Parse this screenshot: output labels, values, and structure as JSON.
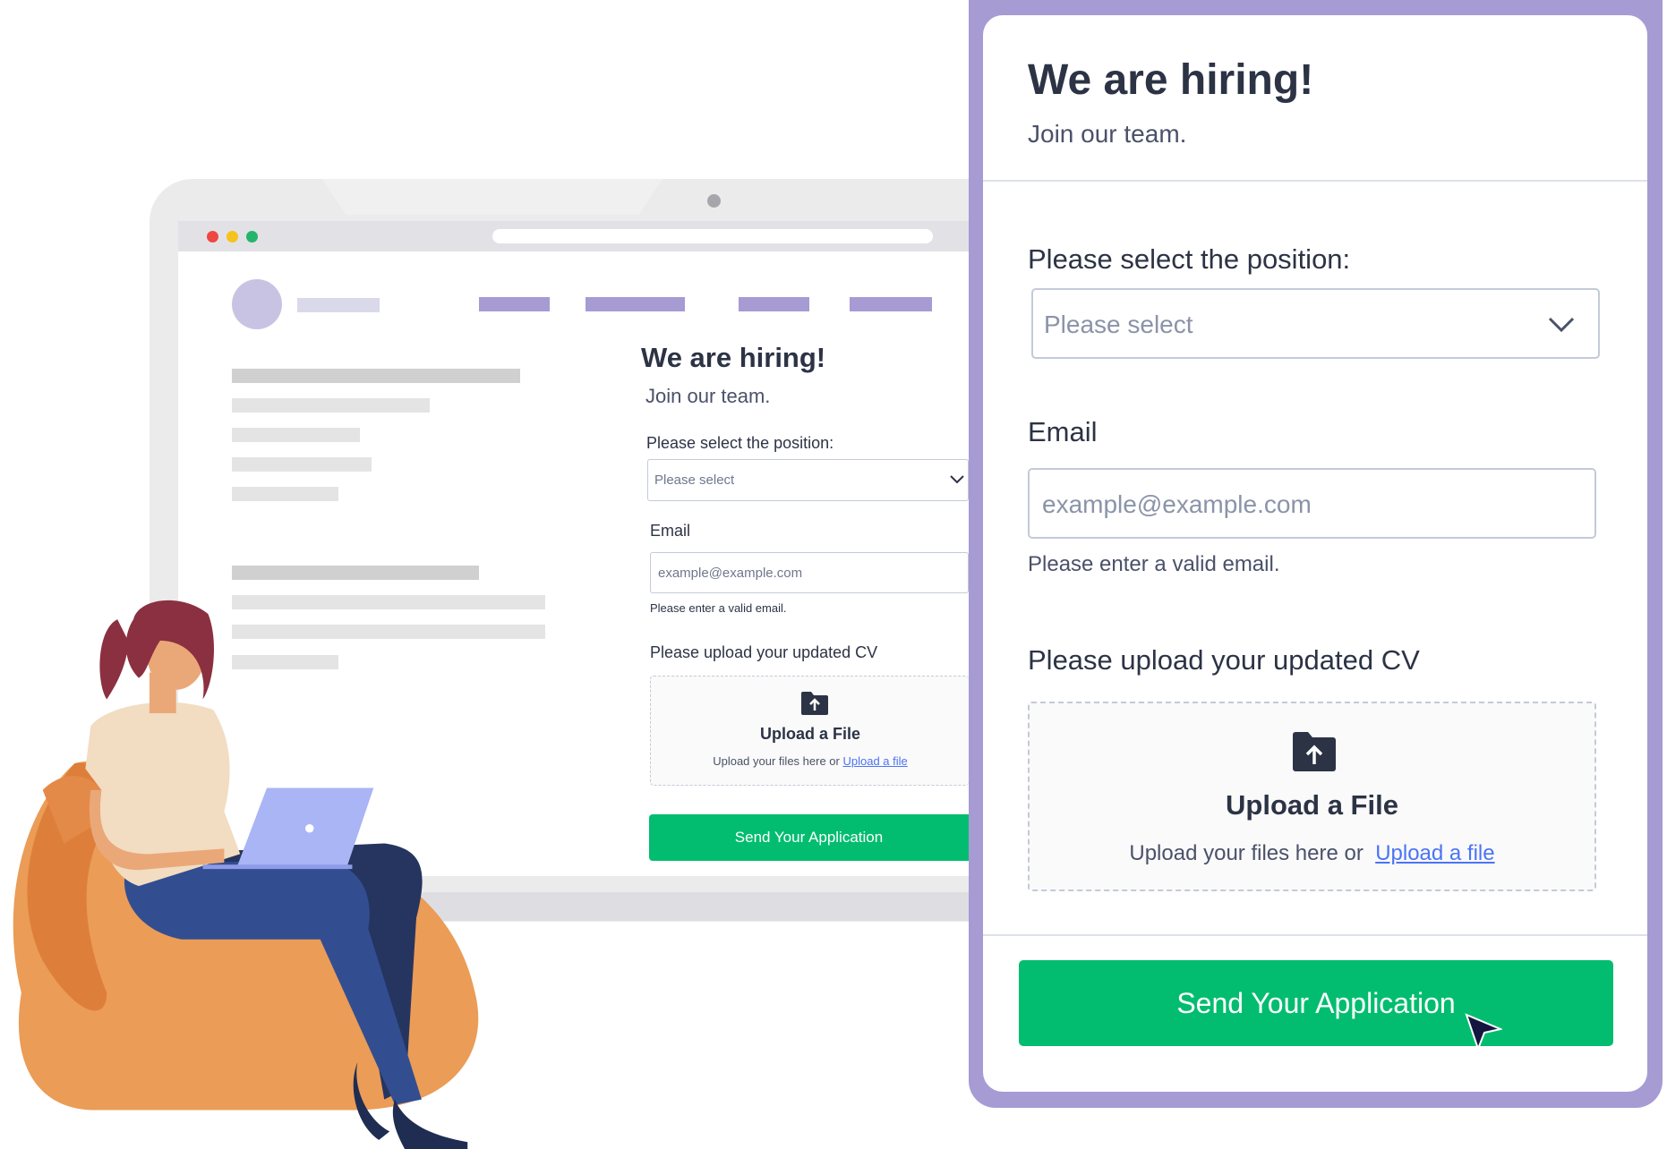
{
  "form": {
    "title": "We are hiring!",
    "subtitle": "Join our team.",
    "position_label": "Please select the position:",
    "position_placeholder": "Please select",
    "email_label": "Email",
    "email_placeholder": "example@example.com",
    "email_hint": "Please enter a valid email.",
    "cv_label": "Please upload your updated CV",
    "upload_title": "Upload a File",
    "upload_text": "Upload your files here or",
    "upload_link": "Upload a file",
    "submit_label": "Send Your Application"
  },
  "preview": {
    "title": "We are hiring!",
    "subtitle": "Join our team.",
    "position_label": "Please select the position:",
    "position_placeholder": "Please select",
    "email_label": "Email",
    "email_placeholder": "example@example.com",
    "email_hint": "Please enter a valid email.",
    "cv_label": "Please upload your updated CV",
    "upload_title": "Upload a File",
    "upload_text": "Upload your files here or",
    "upload_link": "Upload a file",
    "submit_label": "Send Your Application"
  },
  "colors": {
    "accent_purple": "#a69bd3",
    "submit_green": "#02bd6f",
    "link_blue": "#4b73f6",
    "text_dark": "#2c3345"
  },
  "icons": [
    "folder-upload-icon",
    "chevron-down-icon",
    "cursor-arrow-icon"
  ]
}
